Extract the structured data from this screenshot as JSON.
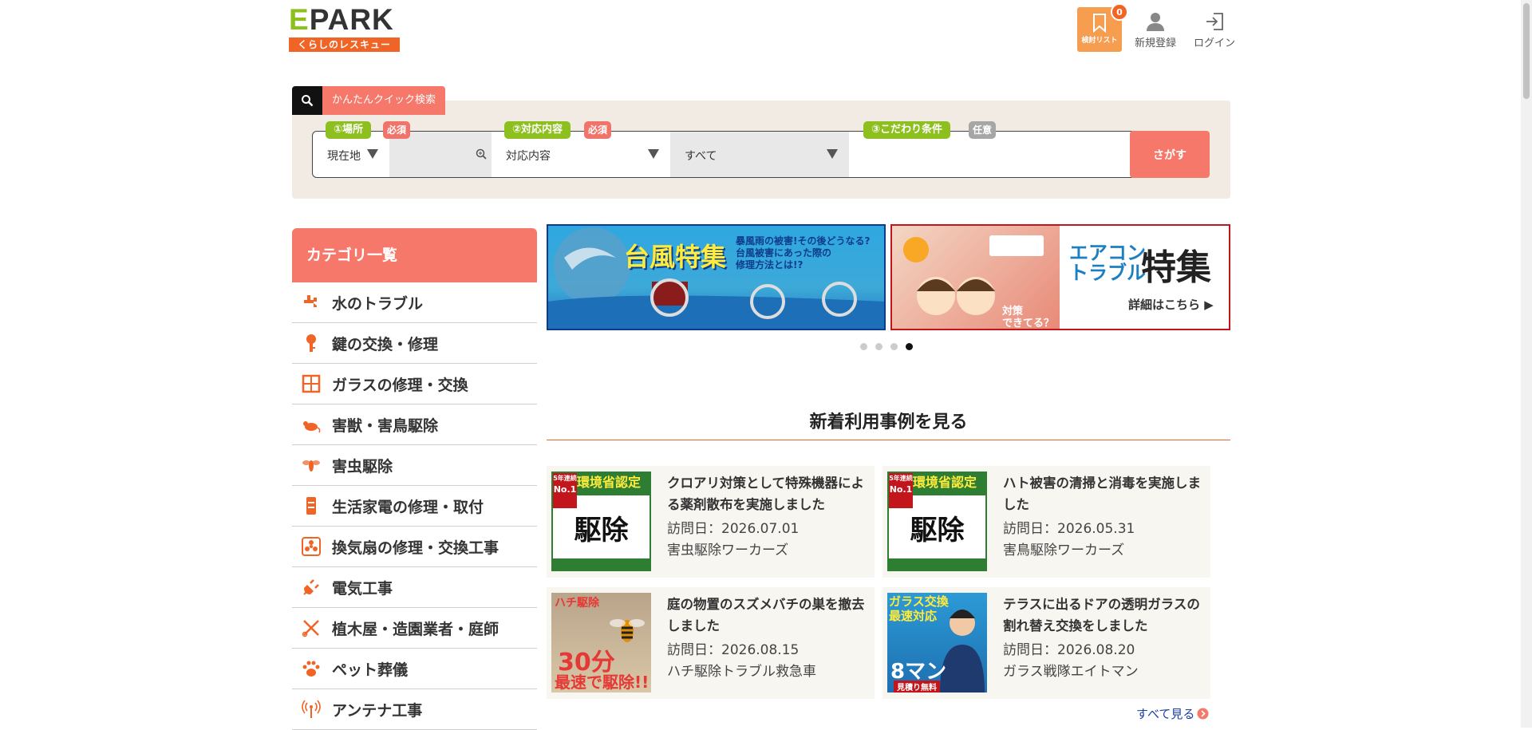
{
  "header": {
    "logo_main": "PARK",
    "logo_e": "E",
    "logo_sub": "くらしのレスキュー",
    "bookmark_label": "検討リスト",
    "bookmark_count": "0",
    "register_label": "新規登録",
    "login_label": "ログイン"
  },
  "search": {
    "tab_label": "かんたんクイック検索",
    "place_tag": "①場所",
    "place_required": "必須",
    "place_value": "現在地",
    "content_tag": "②対応内容",
    "content_required": "必須",
    "content_value": "対応内容",
    "sub_value": "すべて",
    "cond_tag": "③こだわり条件",
    "cond_optional": "任意",
    "button_label": "さがす"
  },
  "sidebar": {
    "title": "カテゴリ一覧",
    "items": [
      {
        "label": "水のトラブル",
        "icon": "faucet-icon"
      },
      {
        "label": "鍵の交換・修理",
        "icon": "key-icon"
      },
      {
        "label": "ガラスの修理・交換",
        "icon": "window-icon"
      },
      {
        "label": "害獣・害鳥駆除",
        "icon": "rat-icon"
      },
      {
        "label": "害虫駆除",
        "icon": "bee-icon"
      },
      {
        "label": "生活家電の修理・取付",
        "icon": "appliance-icon"
      },
      {
        "label": "換気扇の修理・交換工事",
        "icon": "fan-icon"
      },
      {
        "label": "電気工事",
        "icon": "plug-icon"
      },
      {
        "label": "植木屋・造園業者・庭師",
        "icon": "scissors-icon"
      },
      {
        "label": "ペット葬儀",
        "icon": "paw-icon"
      },
      {
        "label": "アンテナ工事",
        "icon": "antenna-icon"
      }
    ]
  },
  "banners": {
    "typhoon_title": "台風特集",
    "typhoon_text1": "暴風雨の被害!その後どうなる?",
    "typhoon_text2": "台風被害にあった際の",
    "typhoon_text3": "修理方法とは!?",
    "aircon_title1a": "エアコン",
    "aircon_title1b": "トラブル",
    "aircon_title2": "特集",
    "aircon_more": "詳細はこちら ▶",
    "aircon_cap1": "対策",
    "aircon_cap2": "できてる？"
  },
  "cases": {
    "title": "新着利用事例を見る",
    "see_all": "すべて見る",
    "items": [
      {
        "title": "クロアリ対策として特殊機器による薬剤散布を実施しました",
        "date": "訪問日：2026.07.01",
        "shop": "害虫駆除ワーカーズ"
      },
      {
        "title": "ハト被害の清掃と消毒を実施しました",
        "date": "訪問日：2026.05.31",
        "shop": "害鳥駆除ワーカーズ"
      },
      {
        "title": "庭の物置のスズメバチの巣を撤去しました",
        "date": "訪問日：2026.08.15",
        "shop": "ハチ駆除トラブル救急車"
      },
      {
        "title": "テラスに出るドアの透明ガラスの割れ替え交換をしました",
        "date": "訪問日：2026.08.20",
        "shop": "ガラス戦隊エイトマン"
      }
    ],
    "thumb_shizai_no1a": "5年連続",
    "thumb_shizai_no1b": "No.1",
    "thumb_shizai_top": "環境省認定",
    "thumb_shizai_mid": "駆除",
    "thumb_hachi_t1": "ハチ駆除",
    "thumb_hachi_t2": "30分",
    "thumb_hachi_t3": "最速で駆除!!",
    "thumb_glass_t1a": "ガラス交換",
    "thumb_glass_t1b": "最速対応",
    "thumb_glass_t2": "8マン",
    "thumb_glass_t3": "見積り無料"
  },
  "colors": {
    "accent": "#f5786a",
    "brand_orange": "#f06426",
    "brand_green": "#8dbf1f"
  }
}
